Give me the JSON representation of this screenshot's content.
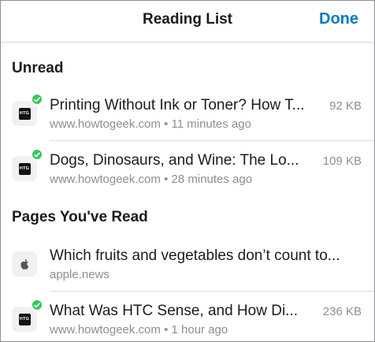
{
  "nav": {
    "title": "Reading List",
    "done_label": "Done"
  },
  "sections": [
    {
      "header": "Unread",
      "items": [
        {
          "title": "Printing Without Ink or Toner? How T...",
          "url": "www.howtogeek.com",
          "time": "11 minutes ago",
          "meta_sep": "•",
          "size": "92 KB",
          "icon": "htg-logo-icon",
          "icon_text": "HTG",
          "unread": true
        },
        {
          "title": "Dogs, Dinosaurs, and Wine: The Lo...",
          "url": "www.howtogeek.com",
          "time": "28 minutes ago",
          "meta_sep": "•",
          "size": "109 KB",
          "icon": "htg-logo-icon",
          "icon_text": "HTG",
          "unread": true
        }
      ]
    },
    {
      "header": "Pages You've Read",
      "items": [
        {
          "title": "Which fruits and vegetables don’t count to...",
          "url": "apple.news",
          "icon": "apple-logo-icon",
          "unread": false
        },
        {
          "title": "What Was HTC Sense, and How Di...",
          "url": "www.howtogeek.com",
          "time": "1 hour ago",
          "meta_sep": "•",
          "size": "236 KB",
          "icon": "htg-logo-icon",
          "icon_text": "HTG",
          "unread": true
        }
      ]
    }
  ],
  "colors": {
    "accent": "#0a79c4",
    "unread_badge": "#34c759",
    "secondary_text": "#8e8e93"
  }
}
